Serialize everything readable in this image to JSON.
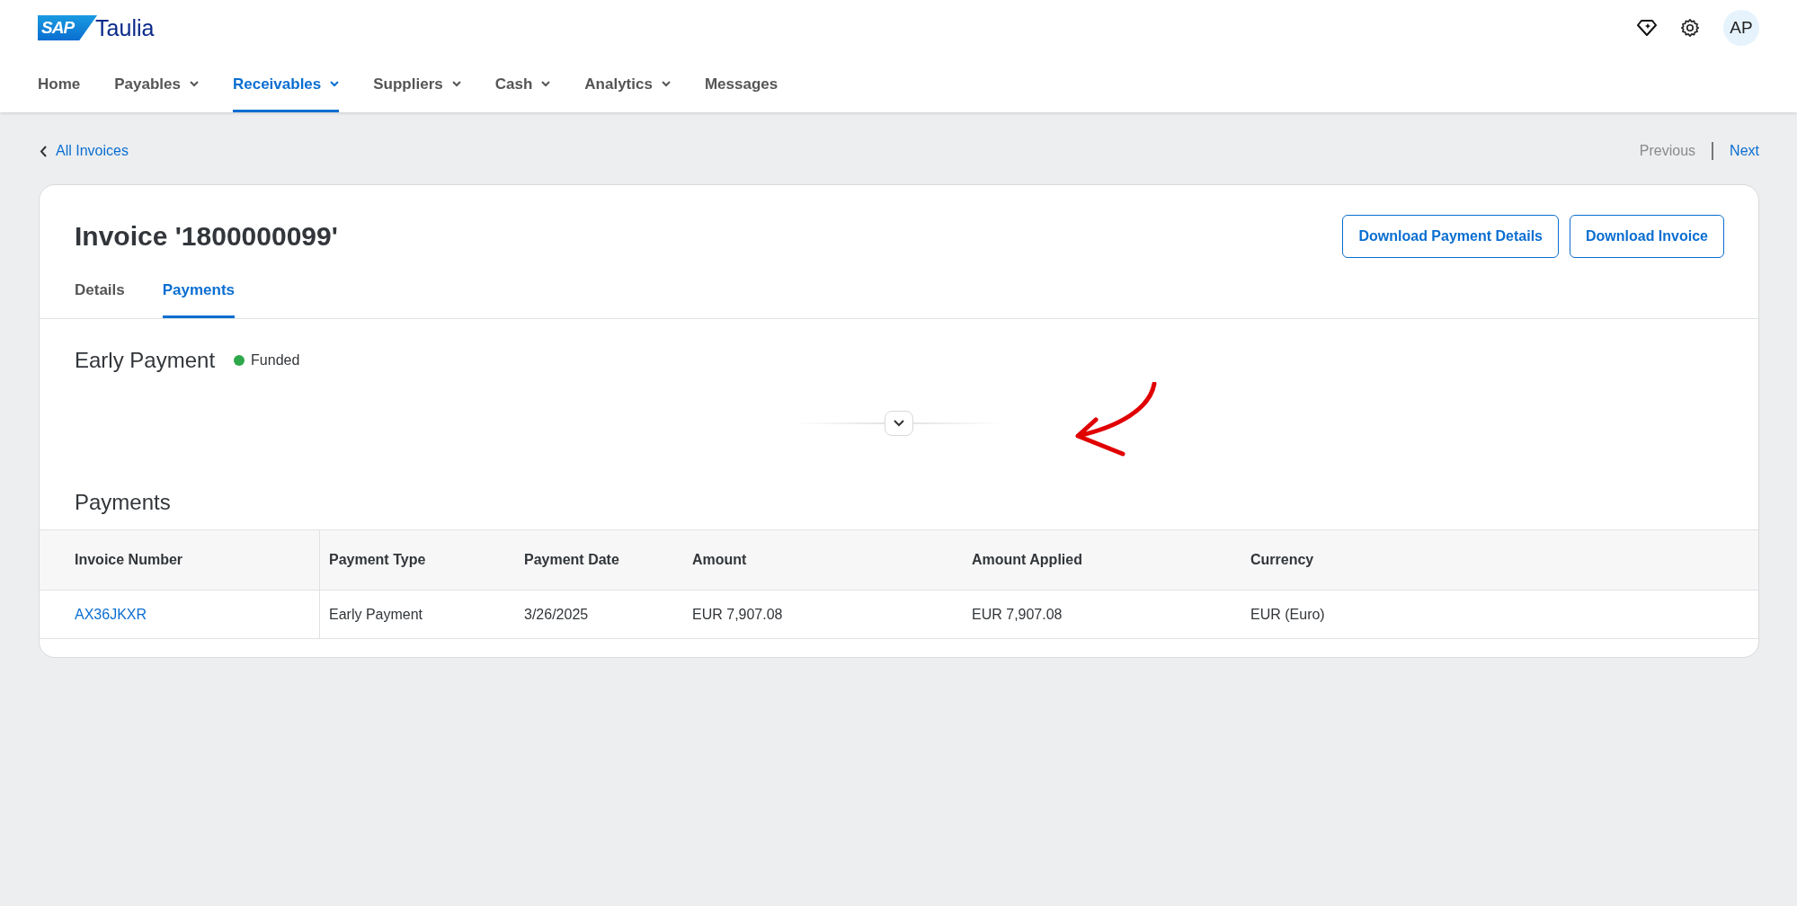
{
  "header": {
    "logo_badge": "SAP",
    "logo_text": "Taulia",
    "avatar": "AP"
  },
  "nav": [
    {
      "label": "Home",
      "dropdown": false,
      "selected": false
    },
    {
      "label": "Payables",
      "dropdown": true,
      "selected": false
    },
    {
      "label": "Receivables",
      "dropdown": true,
      "selected": true
    },
    {
      "label": "Suppliers",
      "dropdown": true,
      "selected": false
    },
    {
      "label": "Cash",
      "dropdown": true,
      "selected": false
    },
    {
      "label": "Analytics",
      "dropdown": true,
      "selected": false
    },
    {
      "label": "Messages",
      "dropdown": false,
      "selected": false
    }
  ],
  "breadcrumb": {
    "back": "All Invoices",
    "previous": "Previous",
    "previous_disabled": true,
    "next": "Next",
    "next_disabled": false
  },
  "invoice": {
    "title": "Invoice '1800000099'",
    "buttons": [
      "Download Payment Details",
      "Download Invoice"
    ],
    "tabs": [
      {
        "label": "Details",
        "selected": false
      },
      {
        "label": "Payments",
        "selected": true
      }
    ],
    "early_payment": {
      "title": "Early Payment",
      "status": "Funded",
      "color": "#2ea84a"
    },
    "payments": {
      "title": "Payments",
      "columns": [
        "Invoice Number",
        "Payment Type",
        "Payment Date",
        "Amount",
        "Amount Applied",
        "Currency"
      ],
      "rows": [
        [
          "AX36JKXR",
          "Early Payment",
          "3/26/2025",
          "EUR 7,907.08",
          "EUR 7,907.08",
          "EUR (Euro)"
        ]
      ]
    }
  }
}
